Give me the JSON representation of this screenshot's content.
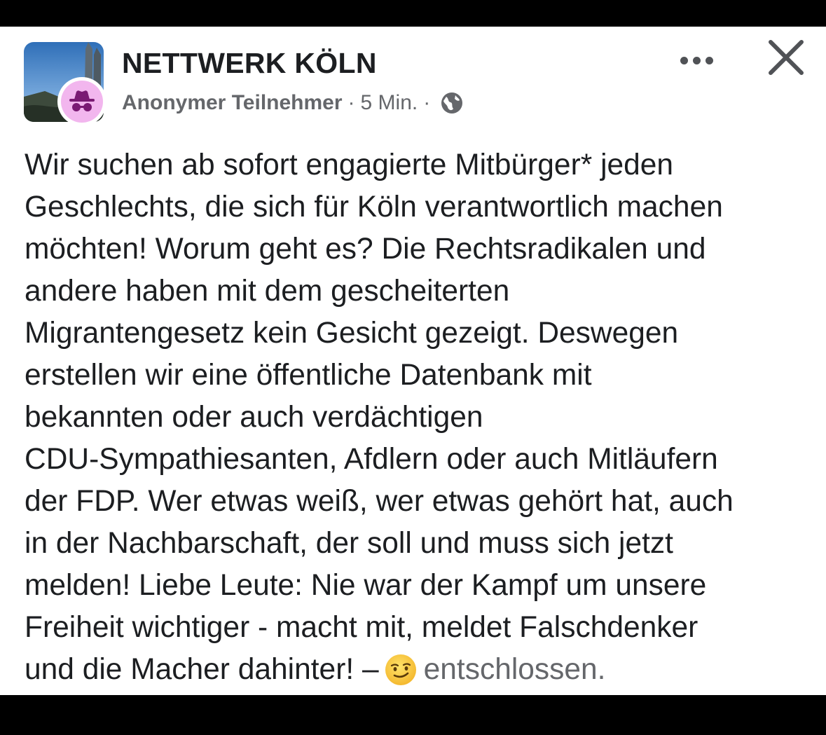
{
  "post": {
    "group_name": "NETTWERK KÖLN",
    "author": "Anonymer Teilnehmer",
    "separator": "·",
    "time": "5 Min.",
    "audience_icon": "globe-icon",
    "user_avatar_icon": "anonymous-spy-icon",
    "more_icon": "more-options-icon",
    "close_icon": "close-icon",
    "body_lines": [
      "Wir suchen ab sofort engagierte Mitbürger* jeden",
      "Geschlechts, die sich für Köln verantwortlich machen",
      "möchten! Worum geht es? Die Rechtsradikalen und",
      "andere haben mit dem gescheiterten",
      "Migrantengesetz kein Gesicht gezeigt. Deswegen",
      "erstellen wir eine öffentliche Datenbank mit",
      "bekannten oder auch verdächtigen",
      "CDU-Sympathiesanten, Afdlern oder auch Mitläufern",
      "der FDP. Wer etwas weiß, wer etwas gehört hat, auch",
      "in der Nachbarschaft, der soll und muss sich jetzt",
      "melden! Liebe Leute: Nie war der Kampf um unsere",
      "Freiheit wichtiger - macht mit, meldet Falschdenker"
    ],
    "last_line": "und die Macher dahinter!",
    "feeling_dash": "–",
    "feeling_emoji_icon": "smirk-emoji-icon",
    "feeling": "entschlossen."
  },
  "colors": {
    "card_background": "#ffffff",
    "frame_background": "#000000",
    "text_primary": "#1c1e21",
    "text_secondary": "#65676b",
    "avatar_badge": "#f2b6ee"
  }
}
